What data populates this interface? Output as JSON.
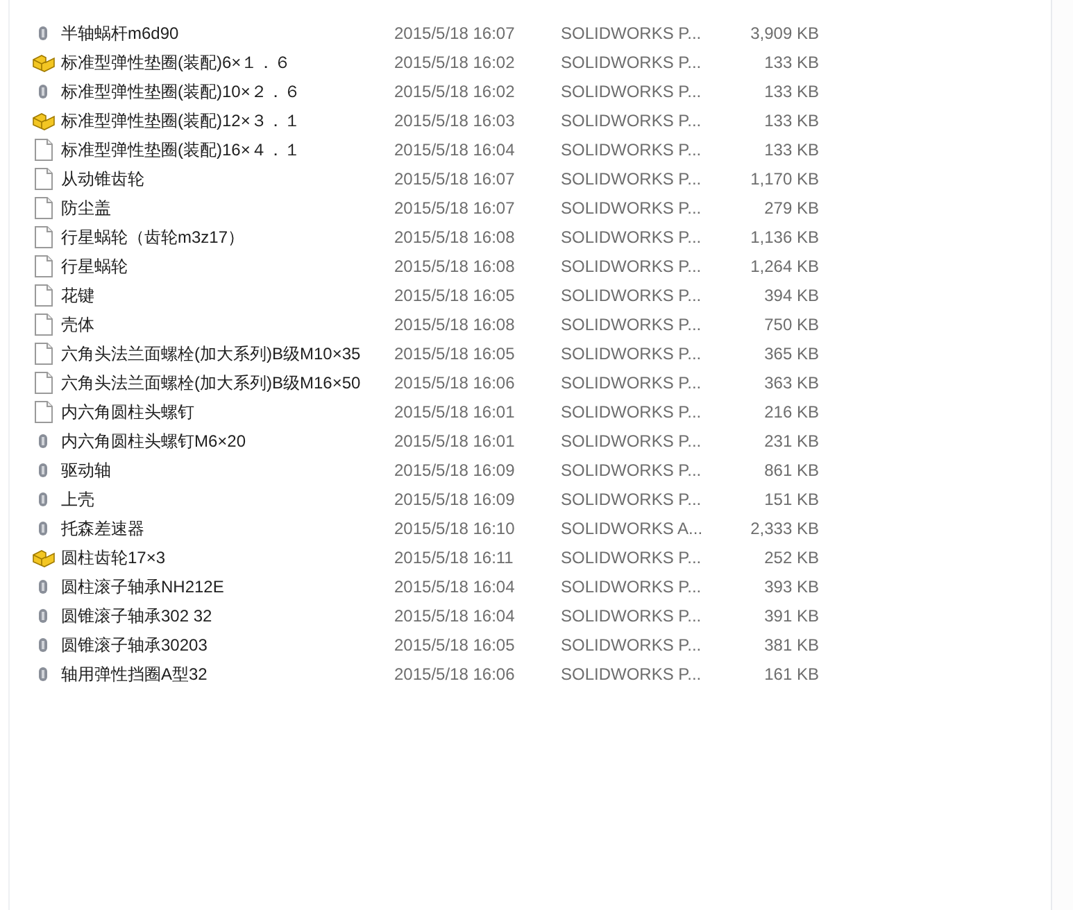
{
  "files": [
    {
      "kind": "thumbnail",
      "name": "半轴蜗杆m6d90",
      "modified": "2015/5/18 16:07",
      "type": "SOLIDWORKS P...",
      "size": "3,909 KB"
    },
    {
      "kind": "assembly",
      "name": "标准型弹性垫圈(装配)6×１．６",
      "modified": "2015/5/18 16:02",
      "type": "SOLIDWORKS P...",
      "size": "133 KB"
    },
    {
      "kind": "thumbnail",
      "name": "标准型弹性垫圈(装配)10×２．６",
      "modified": "2015/5/18 16:02",
      "type": "SOLIDWORKS P...",
      "size": "133 KB"
    },
    {
      "kind": "assembly",
      "name": "标准型弹性垫圈(装配)12×３．１",
      "modified": "2015/5/18 16:03",
      "type": "SOLIDWORKS P...",
      "size": "133 KB"
    },
    {
      "kind": "document",
      "name": "标准型弹性垫圈(装配)16×４．１",
      "modified": "2015/5/18 16:04",
      "type": "SOLIDWORKS P...",
      "size": "133 KB"
    },
    {
      "kind": "document",
      "name": "从动锥齿轮",
      "modified": "2015/5/18 16:07",
      "type": "SOLIDWORKS P...",
      "size": "1,170 KB"
    },
    {
      "kind": "document",
      "name": "防尘盖",
      "modified": "2015/5/18 16:07",
      "type": "SOLIDWORKS P...",
      "size": "279 KB"
    },
    {
      "kind": "document",
      "name": "行星蜗轮（齿轮m3z17）",
      "modified": "2015/5/18 16:08",
      "type": "SOLIDWORKS P...",
      "size": "1,136 KB"
    },
    {
      "kind": "document",
      "name": "行星蜗轮",
      "modified": "2015/5/18 16:08",
      "type": "SOLIDWORKS P...",
      "size": "1,264 KB"
    },
    {
      "kind": "document",
      "name": "花键",
      "modified": "2015/5/18 16:05",
      "type": "SOLIDWORKS P...",
      "size": "394 KB"
    },
    {
      "kind": "document",
      "name": "壳体",
      "modified": "2015/5/18 16:08",
      "type": "SOLIDWORKS P...",
      "size": "750 KB"
    },
    {
      "kind": "document",
      "name": "六角头法兰面螺栓(加大系列)B级M10×35",
      "modified": "2015/5/18 16:05",
      "type": "SOLIDWORKS P...",
      "size": "365 KB"
    },
    {
      "kind": "document",
      "name": "六角头法兰面螺栓(加大系列)B级M16×50",
      "modified": "2015/5/18 16:06",
      "type": "SOLIDWORKS P...",
      "size": "363 KB"
    },
    {
      "kind": "document",
      "name": "内六角圆柱头螺钉",
      "modified": "2015/5/18 16:01",
      "type": "SOLIDWORKS P...",
      "size": "216 KB"
    },
    {
      "kind": "thumbnail",
      "name": "内六角圆柱头螺钉M6×20",
      "modified": "2015/5/18 16:01",
      "type": "SOLIDWORKS P...",
      "size": "231 KB"
    },
    {
      "kind": "thumbnail",
      "name": "驱动轴",
      "modified": "2015/5/18 16:09",
      "type": "SOLIDWORKS P...",
      "size": "861 KB"
    },
    {
      "kind": "thumbnail",
      "name": "上壳",
      "modified": "2015/5/18 16:09",
      "type": "SOLIDWORKS P...",
      "size": "151 KB"
    },
    {
      "kind": "thumbnail",
      "name": "托森差速器",
      "modified": "2015/5/18 16:10",
      "type": "SOLIDWORKS A...",
      "size": "2,333 KB"
    },
    {
      "kind": "assembly",
      "name": "圆柱齿轮17×3",
      "modified": "2015/5/18 16:11",
      "type": "SOLIDWORKS P...",
      "size": "252 KB"
    },
    {
      "kind": "thumbnail",
      "name": "圆柱滚子轴承NH212E",
      "modified": "2015/5/18 16:04",
      "type": "SOLIDWORKS P...",
      "size": "393 KB"
    },
    {
      "kind": "thumbnail",
      "name": "圆锥滚子轴承302 32",
      "modified": "2015/5/18 16:04",
      "type": "SOLIDWORKS P...",
      "size": "391 KB"
    },
    {
      "kind": "thumbnail",
      "name": "圆锥滚子轴承30203",
      "modified": "2015/5/18 16:05",
      "type": "SOLIDWORKS P...",
      "size": "381 KB"
    },
    {
      "kind": "thumbnail",
      "name": "轴用弹性挡圈A型32",
      "modified": "2015/5/18 16:06",
      "type": "SOLIDWORKS P...",
      "size": "161 KB"
    }
  ]
}
